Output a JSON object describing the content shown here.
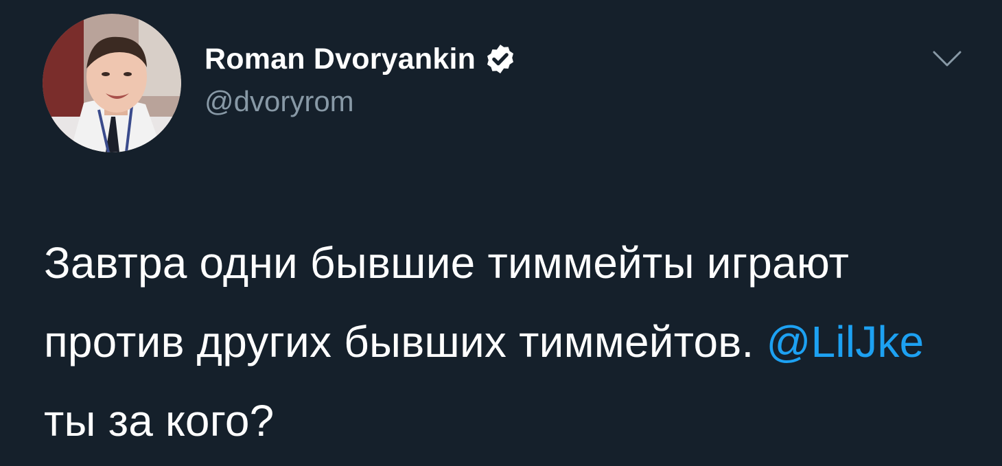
{
  "tweet": {
    "author": {
      "display_name": "Roman Dvoryankin",
      "handle": "@dvoryrom",
      "verified": true,
      "avatar_icon": "profile-photo"
    },
    "menu_icon": "chevron-down-icon",
    "text": {
      "part1": "Завтра одни бывшие тиммейты играют против других бывших тиммейтов. ",
      "mention": "@LilJke",
      "part2": " ты за кого?"
    },
    "colors": {
      "background": "#15202b",
      "text": "#ffffff",
      "secondary_text": "#8899a6",
      "link": "#1da1f2"
    }
  }
}
